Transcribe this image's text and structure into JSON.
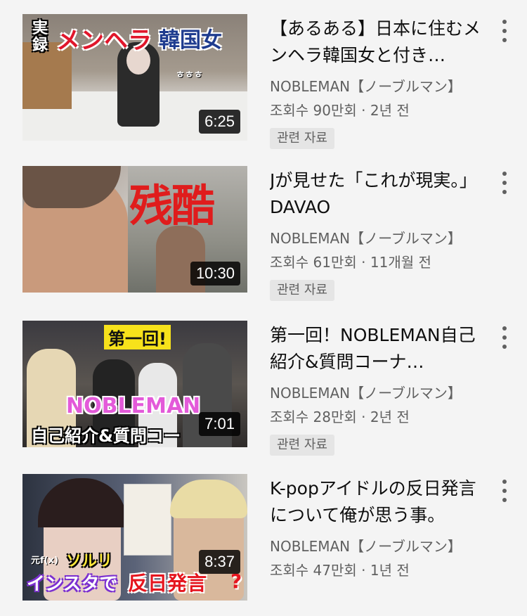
{
  "videos": [
    {
      "title": "【あるある】日本に住むメンヘラ韓国女と付き…",
      "channel": "NOBLEMAN【ノーブルマン】",
      "meta": "조회수 90만회 · 2년 전",
      "badge": "관련 자료",
      "duration": "6:25",
      "thumb_text": [
        "実録",
        "メンヘラ",
        "韓国女",
        "ㅎㅎㅎ"
      ]
    },
    {
      "title": "Jが見せた「これが現実。」DAVAO",
      "channel": "NOBLEMAN【ノーブルマン】",
      "meta": "조회수 61만회 · 11개월 전",
      "badge": "관련 자료",
      "duration": "10:30",
      "thumb_text": [
        "残酷"
      ]
    },
    {
      "title": "第一回！NOBLEMAN自己紹介&質問コーナ…",
      "channel": "NOBLEMAN【ノーブルマン】",
      "meta": "조회수 28만회 · 2년 전",
      "badge": "관련 자료",
      "duration": "7:01",
      "thumb_text": [
        "第一回!",
        "NOBLEMAN",
        "自己紹介&質問コー"
      ]
    },
    {
      "title": "K-popアイドルの反日発言について俺が思う事。",
      "channel": "NOBLEMAN【ノーブルマン】",
      "meta": "조회수 47만회 · 1년 전",
      "duration": "8:37",
      "thumb_text": [
        "元f(x)",
        "ソルリ",
        "インスタで",
        "反日発言",
        "?"
      ]
    }
  ]
}
